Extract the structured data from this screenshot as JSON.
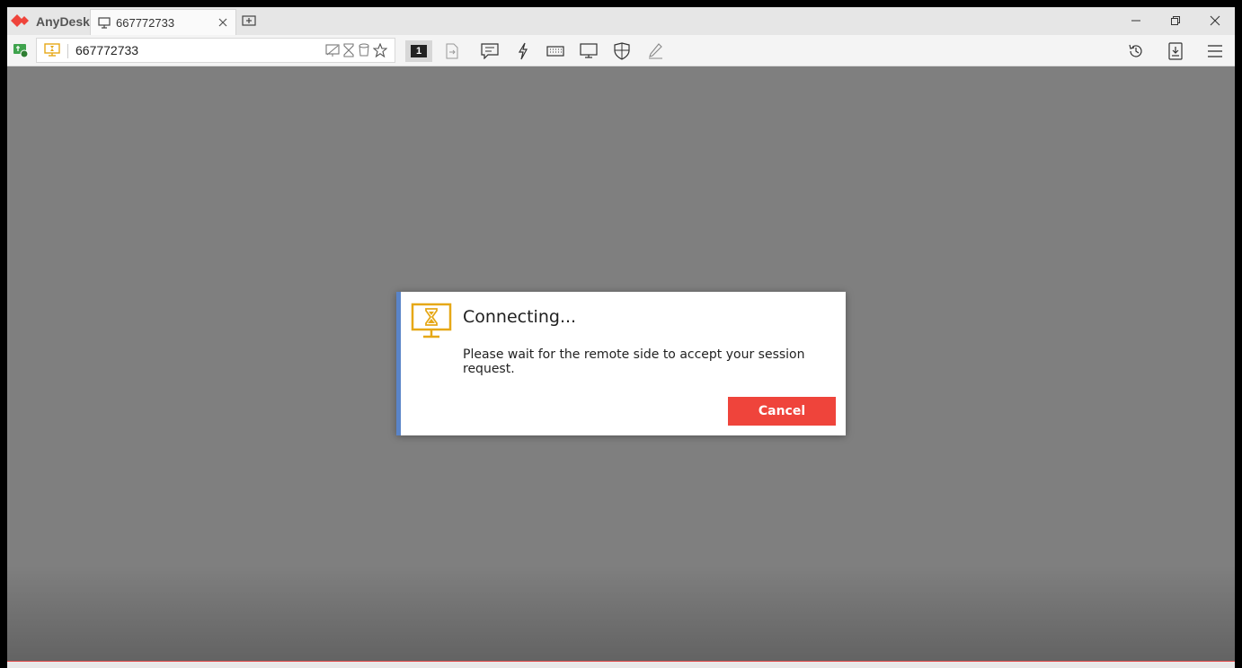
{
  "app": {
    "name": "AnyDesk",
    "brand_color": "#ef443b"
  },
  "tab": {
    "label": "667772733",
    "icon": "monitor-icon"
  },
  "address_bar": {
    "value": "667772733"
  },
  "toolbar": {
    "monitor_number": "1"
  },
  "dialog": {
    "title": "Connecting...",
    "message": "Please wait for the remote side to accept your session request.",
    "cancel_label": "Cancel",
    "icon": "monitor-hourglass-icon",
    "accent_color": "#e6a817"
  }
}
